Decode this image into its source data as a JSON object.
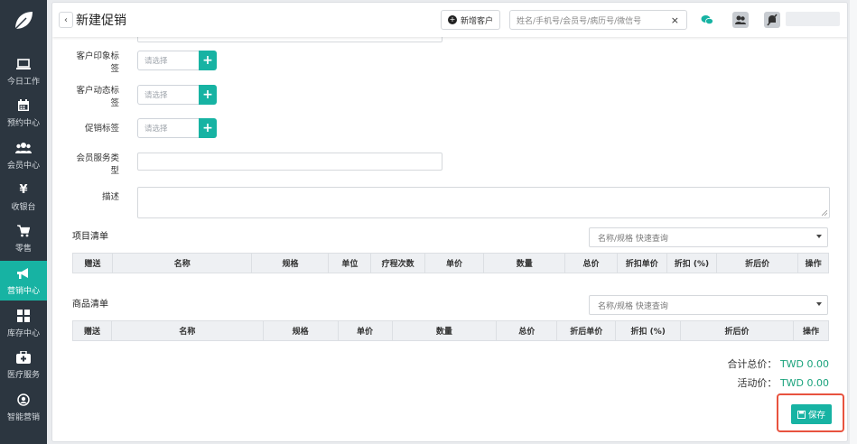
{
  "sidebar": {
    "items": [
      {
        "label": "今日工作",
        "icon": "laptop-icon"
      },
      {
        "label": "预约中心",
        "icon": "calendar-icon"
      },
      {
        "label": "会员中心",
        "icon": "users-icon"
      },
      {
        "label": "收银台",
        "icon": "yen-icon"
      },
      {
        "label": "零售",
        "icon": "cart-icon"
      },
      {
        "label": "营销中心",
        "icon": "megaphone-icon",
        "active": true
      },
      {
        "label": "库存中心",
        "icon": "grid-icon"
      },
      {
        "label": "医疗服务",
        "icon": "medkit-icon"
      },
      {
        "label": "智能营销",
        "icon": "robot-icon"
      }
    ]
  },
  "header": {
    "back": "‹",
    "title": "新建促销",
    "new_client": "新增客户",
    "search_placeholder": "姓名/手机号/会员号/病历号/微信号",
    "search_clear": "×"
  },
  "form": {
    "impression_label": "客户印象标签",
    "dynamic_label": "客户动态标签",
    "promo_label": "促销标签",
    "select_placeholder": "请选择",
    "plus": "+",
    "service_type_label": "会员服务类型",
    "desc_label": "描述"
  },
  "projects": {
    "title": "项目清单",
    "search_placeholder": "名称/规格 快速查询",
    "columns": [
      "赠送",
      "名称",
      "规格",
      "单位",
      "疗程次数",
      "单价",
      "数量",
      "总价",
      "折扣单价",
      "折扣 (%)",
      "折后价",
      "操作"
    ]
  },
  "goods": {
    "title": "商品清单",
    "search_placeholder": "名称/规格 快速查询",
    "columns": [
      "赠送",
      "名称",
      "规格",
      "单价",
      "数量",
      "总价",
      "折后单价",
      "折扣 (%)",
      "折后价",
      "操作"
    ]
  },
  "totals": {
    "total_label": "合计总价：",
    "total_value": "TWD 0.00",
    "activity_label": "活动价：",
    "activity_value": "TWD 0.00"
  },
  "save_label": "保存",
  "colors": {
    "accent": "#17b3a3",
    "sidebar": "#2c3640",
    "highlight": "#e8533f",
    "amount": "#1aa37c"
  }
}
